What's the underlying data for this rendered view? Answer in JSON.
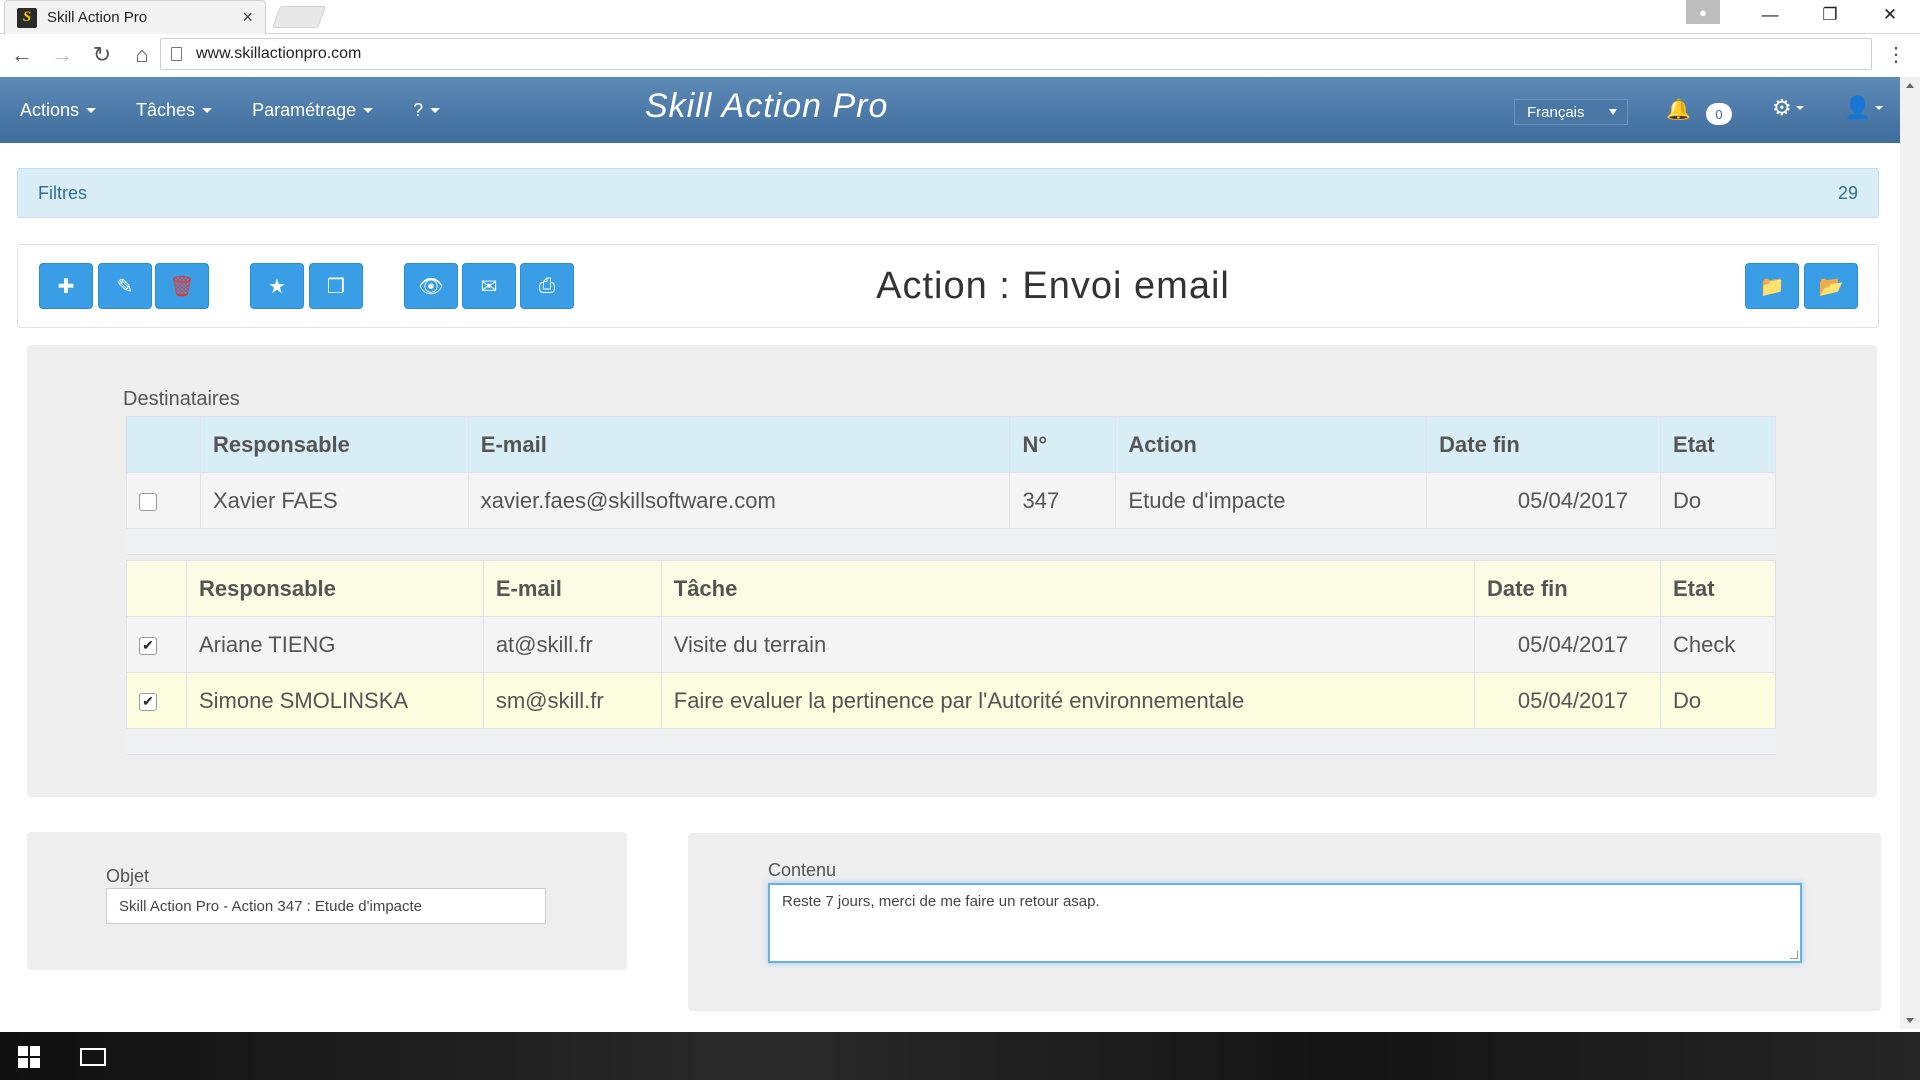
{
  "browser": {
    "tab_title": "Skill Action Pro",
    "tab_close": "×",
    "favicon_letter": "S",
    "url": "www.skillactionpro.com",
    "icons": [
      "back-icon",
      "forward-icon",
      "reload-icon",
      "home-icon",
      "page-icon",
      "menu-icon"
    ]
  },
  "navbar": {
    "menus": [
      "Actions",
      "Tâches",
      "Paramétrage",
      "?"
    ],
    "brand": "Skill Action Pro",
    "language": "Français",
    "notifications_count": "0",
    "accent_color": "#4a78a6"
  },
  "filters": {
    "label": "Filtres",
    "count": "29"
  },
  "action_bar": {
    "title": "Action : Envoi email",
    "buttons": [
      "add-icon",
      "edit-icon",
      "trash-icon",
      "star-icon",
      "copy-icon",
      "eye-icon",
      "envelope-icon",
      "print-icon",
      "folder-icon",
      "folder-open-icon"
    ],
    "button_color": "#3a9ee6"
  },
  "recipients": {
    "label": "Destinataires",
    "actions_table": {
      "headers": [
        "",
        "Responsable",
        "E-mail",
        "N°",
        "Action",
        "Date fin",
        "Etat"
      ],
      "rows": [
        {
          "checked": false,
          "responsable": "Xavier FAES",
          "email": "xavier.faes@skillsoftware.com",
          "num": "347",
          "action": "Etude d'impacte",
          "date_fin": "05/04/2017",
          "etat": "Do"
        }
      ]
    },
    "tasks_table": {
      "headers": [
        "",
        "Responsable",
        "E-mail",
        "Tâche",
        "Date fin",
        "Etat"
      ],
      "rows": [
        {
          "checked": true,
          "responsable": "Ariane TIENG",
          "email": "at@skill.fr",
          "tache": "Visite du terrain",
          "date_fin": "05/04/2017",
          "etat": "Check"
        },
        {
          "checked": true,
          "responsable": "Simone SMOLINSKA",
          "email": "sm@skill.fr",
          "tache": "Faire evaluer la pertinence par l'Autorité environnementale",
          "date_fin": "05/04/2017",
          "etat": "Do"
        }
      ]
    }
  },
  "objet": {
    "label": "Objet",
    "value": "Skill Action Pro - Action 347 : Etude d'impacte"
  },
  "contenu": {
    "label": "Contenu",
    "value": "Reste 7 jours, merci de me faire un retour asap."
  },
  "taskbar": {
    "icons": [
      "windows-start-icon",
      "task-view-icon"
    ]
  }
}
